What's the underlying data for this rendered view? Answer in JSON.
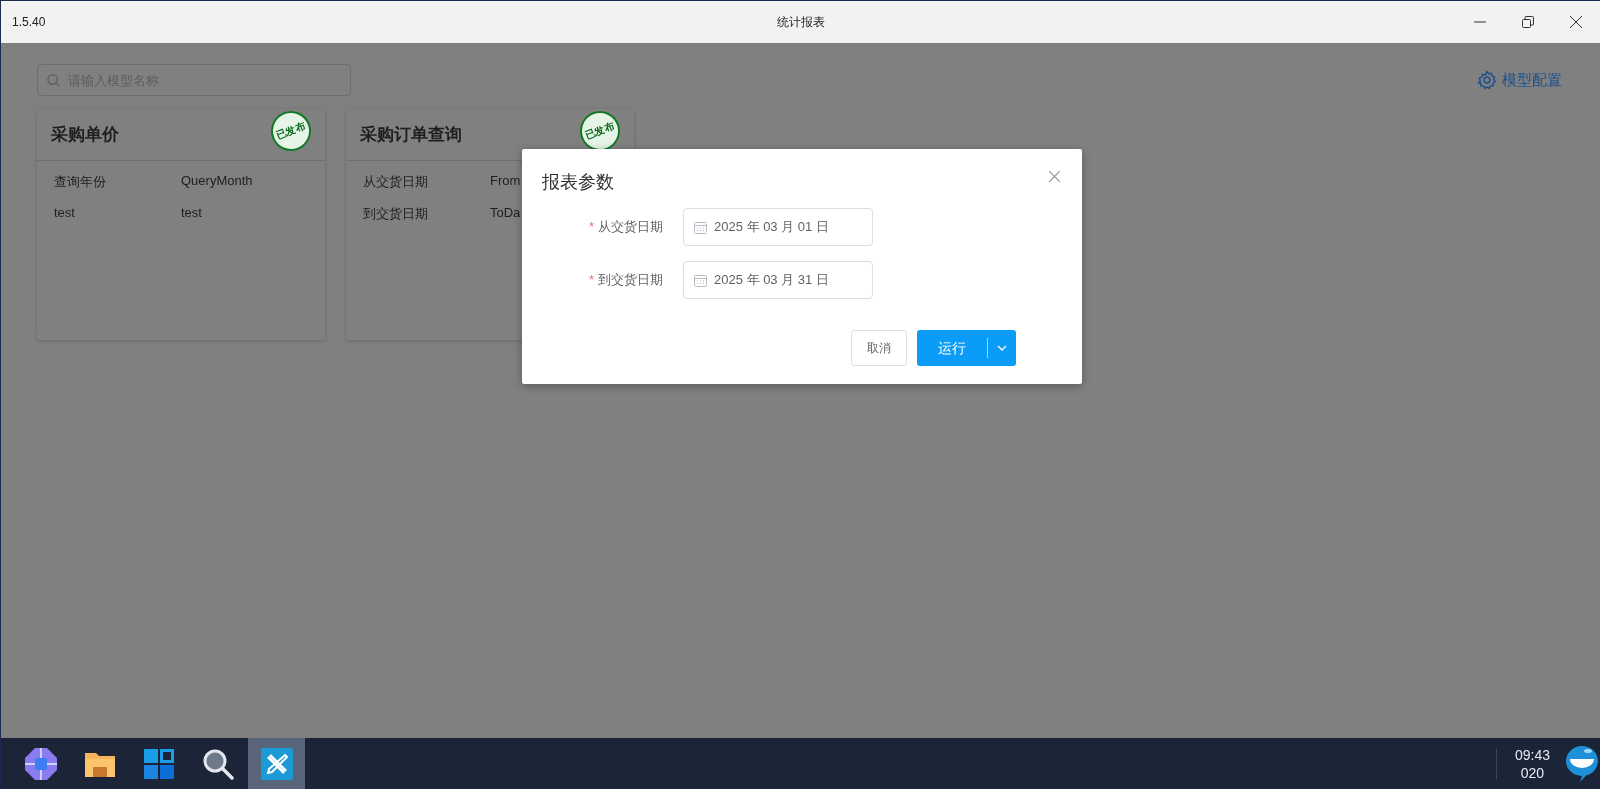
{
  "window": {
    "version": "1.5.40",
    "title": "统计报表"
  },
  "search": {
    "placeholder": "请输入模型名称"
  },
  "config_link": "模型配置",
  "cards": [
    {
      "title": "采购单价",
      "badge": "已发布",
      "params": [
        {
          "name": "查询年份",
          "field": "QueryMonth"
        },
        {
          "name": "test",
          "field": "test"
        }
      ]
    },
    {
      "title": "采购订单查询",
      "badge": "已发布",
      "params": [
        {
          "name": "从交货日期",
          "field": "From"
        },
        {
          "name": "到交货日期",
          "field": "ToDa"
        }
      ]
    }
  ],
  "dialog": {
    "title": "报表参数",
    "fields": [
      {
        "label": "从交货日期",
        "required_mark": "*",
        "value": "2025 年 03 月 01 日"
      },
      {
        "label": "到交货日期",
        "required_mark": "*",
        "value": "2025 年 03 月 31 日"
      }
    ],
    "cancel": "取消",
    "run": "运行"
  },
  "taskbar": {
    "apps": [
      {
        "kind": "hub",
        "selected": false
      },
      {
        "kind": "folder",
        "selected": false
      },
      {
        "kind": "start",
        "selected": false
      },
      {
        "kind": "search",
        "selected": false
      },
      {
        "kind": "tools",
        "selected": true
      }
    ],
    "time": "09:43",
    "date": "020"
  }
}
